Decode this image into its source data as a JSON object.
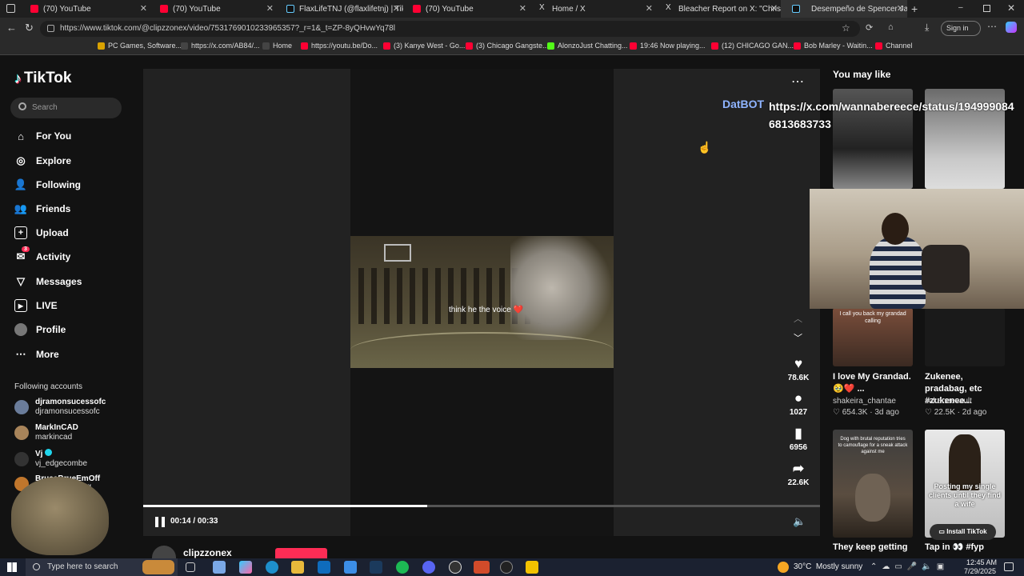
{
  "tabs": [
    {
      "title": "(70) YouTube",
      "color": "#ff0033"
    },
    {
      "title": "(70) YouTube",
      "color": "#ff0033"
    },
    {
      "title": "FlaxLifeTNJ (@flaxlifetnj) | TikTok",
      "color": "#111111"
    },
    {
      "title": "(70) YouTube",
      "color": "#ff0033"
    },
    {
      "title": "Home / X",
      "color": "#000000"
    },
    {
      "title": "Bleacher Report on X: \"Chris Paul",
      "color": "#000000"
    },
    {
      "title": "Desempeño de Spencer Jan",
      "color": "#111111"
    }
  ],
  "address": {
    "url": "https://www.tiktok.com/@clipzzonex/video/7531769010233965357?_r=1&_t=ZP-8yQHvwYq78l",
    "signin": "Sign in"
  },
  "bookmarks": [
    "PC Games, Software...",
    "https://x.com/AB84/...",
    "Home",
    "https://youtu.be/Do...",
    "(3) Kanye West - Go...",
    "(3) Chicago Gangste...",
    "AlonzoJust Chatting...",
    "19:46 Now playing...",
    "(12) CHICAGO GAN...",
    "Bob Marley - Waitin...",
    "Channel"
  ],
  "sidebar": {
    "logo": "TikTok",
    "search_placeholder": "Search",
    "nav": [
      {
        "label": "For You",
        "icon": "home-icon"
      },
      {
        "label": "Explore",
        "icon": "compass-icon"
      },
      {
        "label": "Following",
        "icon": "following-icon"
      },
      {
        "label": "Friends",
        "icon": "friends-icon"
      },
      {
        "label": "Upload",
        "icon": "upload-icon"
      },
      {
        "label": "Activity",
        "icon": "activity-icon",
        "badge": "3"
      },
      {
        "label": "Messages",
        "icon": "messages-icon"
      },
      {
        "label": "LIVE",
        "icon": "live-icon"
      },
      {
        "label": "Profile",
        "icon": "profile-icon"
      },
      {
        "label": "More",
        "icon": "more-icon"
      }
    ],
    "following_title": "Following accounts",
    "accounts": [
      {
        "name": "djramonsucessofc",
        "handle": "djramonsucessofc"
      },
      {
        "name": "MarkInCAD",
        "handle": "markincad"
      },
      {
        "name": "Vj",
        "handle": "vj_edgecombe"
      },
      {
        "name": "BruceBrueEmOff",
        "handle": "brucebrueemoff"
      }
    ]
  },
  "video": {
    "caption": "think he the voice ❤️",
    "time": "00:14 / 00:33",
    "progress": 0.42,
    "author": "clipzzonex",
    "likes": "78.6K",
    "comments": "1027",
    "saves": "6956",
    "shares": "22.6K"
  },
  "overlay": {
    "bot": "DatBOT",
    "link": "https://x.com/wannabereece/status/1949990846813683733"
  },
  "right": {
    "title": "You may like",
    "items": [
      {
        "title": "I love My Grandad. 🥹❤️ ...",
        "author": "shakeira_chantae",
        "stats": "654.3K · 3d ago"
      },
      {
        "title": "Zukenee, pradabag, etc #zukenee...",
        "author": "zukeneevault",
        "stats": "22.5K · 2d ago"
      },
      {
        "title": "They keep getting",
        "author": "",
        "stats": ""
      },
      {
        "title": "Tap in 👀 #fyp",
        "author": "",
        "stats": ""
      }
    ],
    "thumb_texts": [
      "Posting my single clients until they find a wife",
      "Dog with brutal reputation tries to camouflage for a sneak attack against me",
      "I call you back my grandad calling"
    ],
    "install": "Install TikTok"
  },
  "taskbar": {
    "search": "Type here to search",
    "weather": "30°C  Mostly sunny",
    "time": "12:45 AM",
    "date": "7/29/2025"
  }
}
